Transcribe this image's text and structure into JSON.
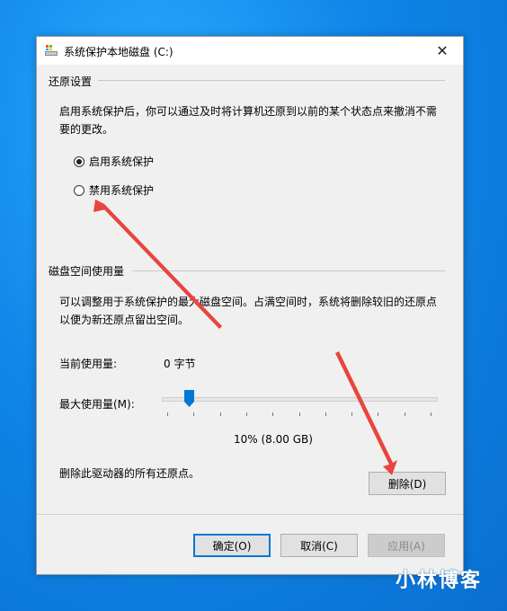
{
  "window": {
    "title": "系统保护本地磁盘 (C:)",
    "close_glyph": "✕"
  },
  "restore_settings": {
    "group_label": "还原设置",
    "description_line1": "启用系统保护后，你可以通过及时将计算机还原到以前的某个状态点来撤消不需",
    "description_line2": "要的更改。",
    "options": [
      {
        "label": "启用系统保护",
        "selected": true
      },
      {
        "label": "禁用系统保护",
        "selected": false
      }
    ]
  },
  "disk_usage": {
    "group_label": "磁盘空间使用量",
    "description_line1": "可以调整用于系统保护的最大磁盘空间。占满空间时，系统将删除较旧的还原点",
    "description_line2": "以便为新还原点留出空间。",
    "current_usage_label": "当前使用量:",
    "current_usage_value": "0 字节",
    "max_usage_label": "最大使用量(M):",
    "max_usage_fraction": 0.1,
    "max_usage_value": "10% (8.00 GB)",
    "delete_description": "删除此驱动器的所有还原点。",
    "delete_button": "删除(D)"
  },
  "footer": {
    "ok_button": "确定(O)",
    "cancel_button": "取消(C)",
    "apply_button": "应用(A)"
  },
  "watermark": "小林博客",
  "colors": {
    "annotation_arrow": "#e8453c",
    "default_button_border": "#0078d7"
  }
}
